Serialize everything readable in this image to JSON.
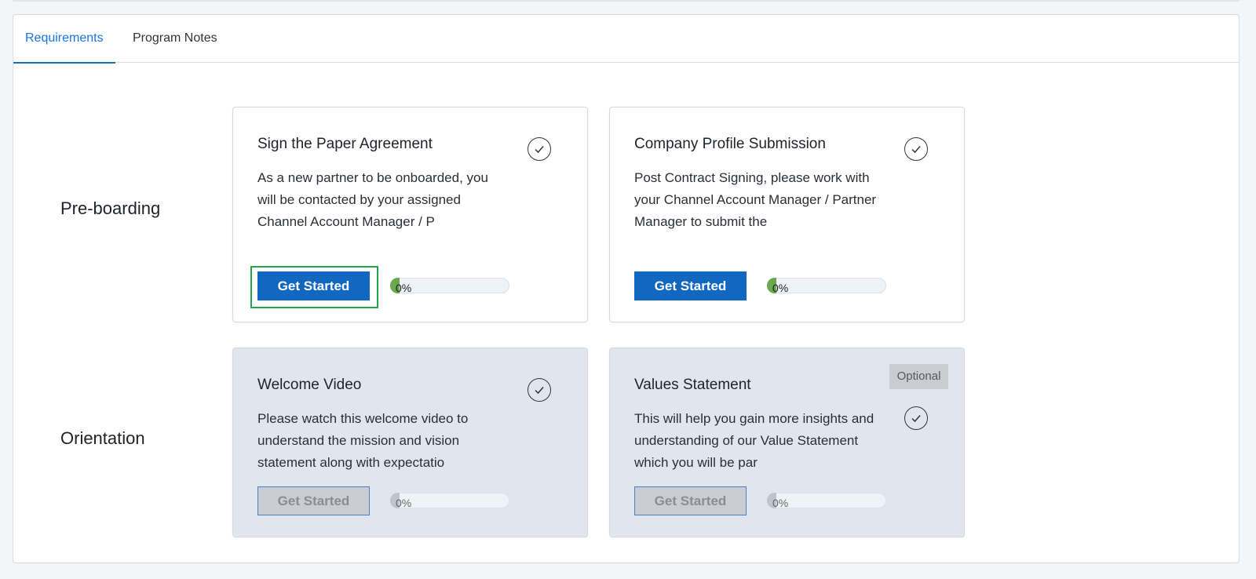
{
  "tabs": [
    {
      "label": "Requirements",
      "active": true
    },
    {
      "label": "Program Notes",
      "active": false
    }
  ],
  "sections": [
    {
      "label": "Pre-boarding"
    },
    {
      "label": "Orientation"
    }
  ],
  "cards": [
    {
      "title": "Sign the Paper Agreement",
      "description": "As a new partner to be onboarded, you will be contacted by your assigned Channel Account Manager / P",
      "button_label": "Get Started",
      "progress_label": "0%",
      "progress": 0,
      "locked": false
    },
    {
      "title": "Company Profile Submission",
      "description": "Post Contract Signing, please work with your Channel Account Manager / Partner Manager to submit the",
      "button_label": "Get Started",
      "progress_label": "0%",
      "progress": 0,
      "locked": false
    },
    {
      "title": "Welcome Video",
      "description": "Please watch this welcome video to understand the mission and vision statement along with expectatio",
      "button_label": "Get Started",
      "progress_label": "0%",
      "progress": 0,
      "locked": true
    },
    {
      "title": "Values Statement",
      "description": "This will help you gain more insights and understanding of our Value Statement which you will be par",
      "button_label": "Get Started",
      "progress_label": "0%",
      "progress": 0,
      "locked": true,
      "badge": "Optional"
    }
  ],
  "colors": {
    "accent": "#1a73e8",
    "primary_button": "#1268c1",
    "progress_active": "#6aa84f",
    "progress_locked": "#c0c4ca",
    "focus_ring": "#1ea84a",
    "locked_card_bg": "#e1e6ee"
  },
  "icons": {
    "complete": "check-circle-icon"
  }
}
